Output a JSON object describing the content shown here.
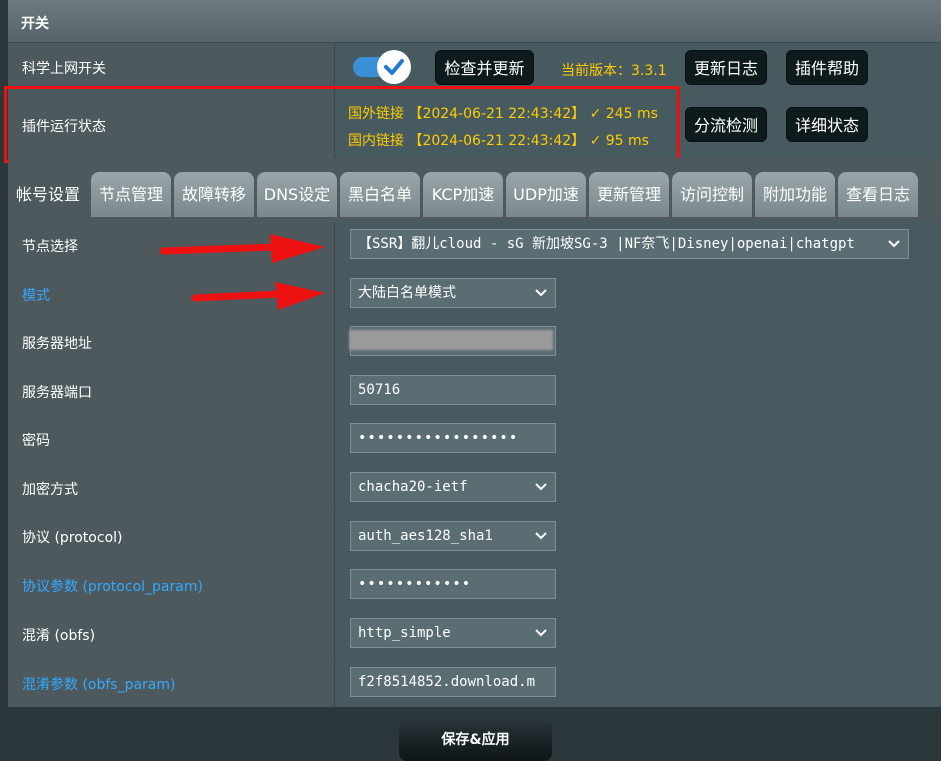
{
  "header": {
    "title": "开关"
  },
  "switch_row": {
    "label": "科学上网开关",
    "toggle_on": true,
    "check_update_button": "检查并更新",
    "version_text": "当前版本：3.3.1",
    "changelog_button": "更新日志",
    "help_button": "插件帮助"
  },
  "status_row": {
    "label": "插件运行状态",
    "foreign_status": "国外链接 【2024-06-21 22:43:42】 ✓  245 ms",
    "domestic_status": "国内链接 【2024-06-21 22:43:42】 ✓  95 ms",
    "split_test_button": "分流检测",
    "detail_button": "详细状态"
  },
  "tabs": [
    {
      "label": "帐号设置"
    },
    {
      "label": "节点管理"
    },
    {
      "label": "故障转移"
    },
    {
      "label": "DNS设定"
    },
    {
      "label": "黑白名单"
    },
    {
      "label": "KCP加速"
    },
    {
      "label": "UDP加速"
    },
    {
      "label": "更新管理"
    },
    {
      "label": "访问控制"
    },
    {
      "label": "附加功能"
    },
    {
      "label": "查看日志"
    }
  ],
  "form": {
    "node": {
      "label": "节点选择",
      "value": "【SSR】翻儿cloud - sG 新加坡SG-3 |NF奈飞|Disney|openai|chatgpt"
    },
    "mode": {
      "label": "模式",
      "value": "大陆白名单模式"
    },
    "server": {
      "label": "服务器地址",
      "value": ""
    },
    "port": {
      "label": "服务器端口",
      "value": "50716"
    },
    "password": {
      "label": "密码",
      "value": "•••••••••••••••••"
    },
    "method": {
      "label": "加密方式",
      "value": "chacha20-ietf"
    },
    "protocol": {
      "label": "协议 (protocol)",
      "value": "auth_aes128_sha1"
    },
    "protocol_param": {
      "label": "协议参数 (protocol_param)",
      "value": "••••••••••••"
    },
    "obfs": {
      "label": "混淆 (obfs)",
      "value": "http_simple"
    },
    "obfs_param": {
      "label": "混淆参数 (obfs_param)",
      "value": "f2f8514852.download.m"
    }
  },
  "save_button": "保存&应用",
  "colors": {
    "accent_link": "#33aaff",
    "status_yellow": "#ffcc00",
    "toggle_blue": "#3a8fd6",
    "annotation_red": "#ee1111"
  }
}
